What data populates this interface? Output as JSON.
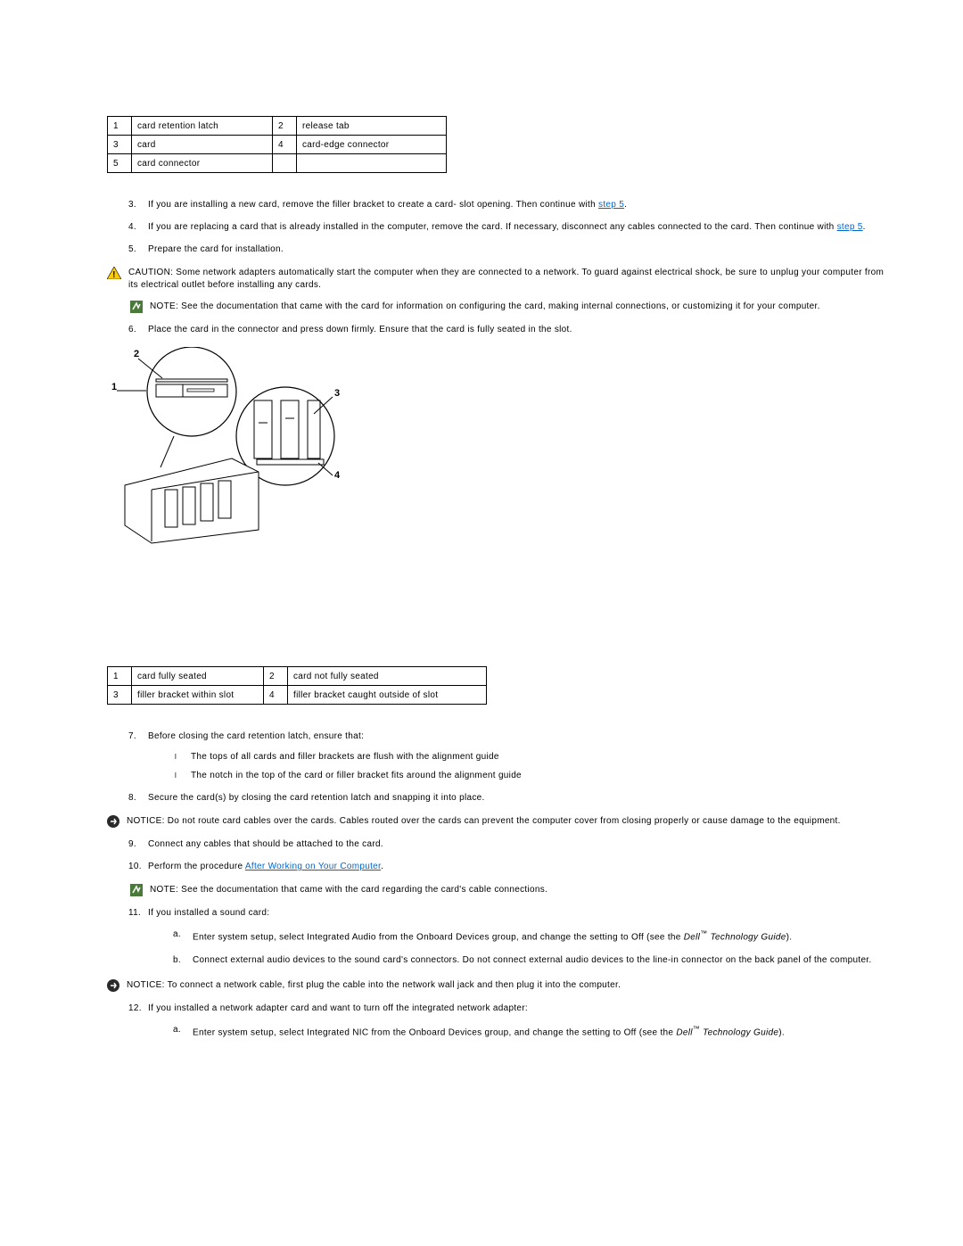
{
  "legend1": {
    "r1c1": "1",
    "r1c2": "card retention latch",
    "r1c3": "2",
    "r1c4": "release tab",
    "r2c1": "3",
    "r2c2": "card",
    "r2c3": "4",
    "r2c4": "card-edge connector",
    "r3c1": "5",
    "r3c2": "card connector",
    "r3c3": "",
    "r3c4": ""
  },
  "step3": {
    "text_a": "If you are installing a new card, remove the filler bracket to create a card- slot opening. Then continue with ",
    "link": "step 5",
    "text_b": "."
  },
  "step4": {
    "text_a": "If you are replacing a card that is already installed in the computer, remove the card. If necessary, disconnect any cables connected to the card. Then continue with ",
    "link": "step 5",
    "text_b": "."
  },
  "step5": "Prepare the card for installation.",
  "caution1": {
    "label": "CAUTION:",
    "text": " Some network adapters automatically start the computer when they are connected to a network. To guard against electrical shock, be sure to unplug your computer from its electrical outlet before installing any cards."
  },
  "note1": {
    "label": "NOTE:",
    "text": " See the documentation that came with the card for information on configuring the card, making internal connections, or customizing it for your computer."
  },
  "step6": "Place the card in the connector and press down firmly. Ensure that the card is fully seated in the slot.",
  "fig_labels": {
    "n1": "1",
    "n2": "2",
    "n3": "3",
    "n4": "4"
  },
  "legend2": {
    "r1c1": "1",
    "r1c2": "card fully seated",
    "r1c3": "2",
    "r1c4": "card not fully seated",
    "r2c1": "3",
    "r2c2": "filler bracket within slot",
    "r2c3": "4",
    "r2c4": "filler bracket caught outside of slot"
  },
  "step7": {
    "text": "Before closing the card retention latch, ensure that:",
    "sub1": "The tops of all cards and filler brackets are flush with the alignment guide",
    "sub2": "The notch in the top of the card or filler bracket fits around the alignment guide"
  },
  "step8": "Secure the card(s) by closing the card retention latch and snapping it into place.",
  "notice1": {
    "label": "NOTICE:",
    "text": " Do not route card cables over the cards. Cables routed over the cards can prevent the computer cover from closing properly or cause damage to the equipment."
  },
  "step9": "Connect any cables that should be attached to the card.",
  "step10": {
    "text_a": "Perform the procedure ",
    "link": "After Working on Your Computer",
    "text_b": "."
  },
  "note2": {
    "label": "NOTE:",
    "text": " See the documentation that came with the card regarding the card's cable connections."
  },
  "step11": {
    "text": "If you installed a sound card:",
    "a_pre": "Enter system setup, select Integrated Audio from the Onboard Devices group, and change the setting to Off (see the ",
    "a_italic": "Dell",
    "a_tm": "™",
    "a_italic2": " Technology Guide",
    "a_post": ").",
    "b": "Connect external audio devices to the sound card's connectors. Do not connect external audio devices to the line-in connector on the back panel of the computer."
  },
  "notice2": {
    "label": "NOTICE:",
    "text": " To connect a network cable, first plug the cable into the network wall jack and then plug it into the computer."
  },
  "step12": {
    "text": "If you installed a network adapter card and want to turn off the integrated network adapter:",
    "a_pre": "Enter system setup, select Integrated NIC from the Onboard Devices group, and change the setting to Off (see the ",
    "a_italic": "Dell",
    "a_tm": "™",
    "a_italic2": " Technology Guide",
    "a_post": ")."
  }
}
